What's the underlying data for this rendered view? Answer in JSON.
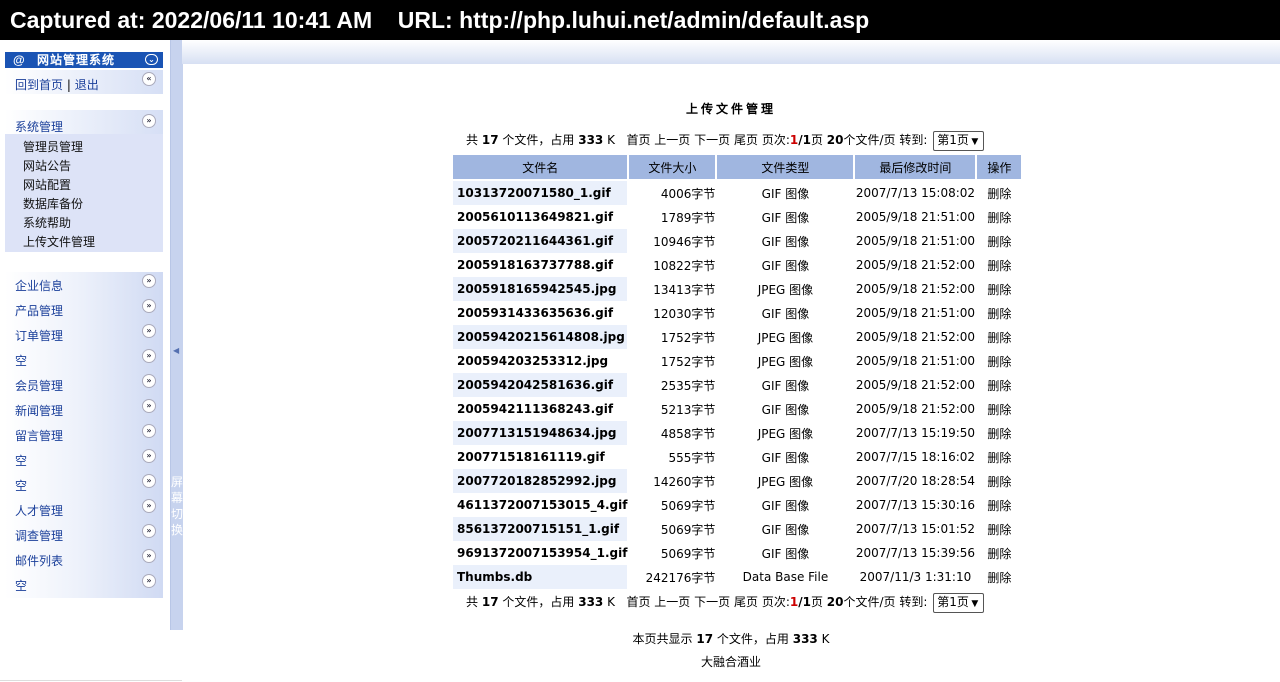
{
  "capture": {
    "text": "Captured at: 2022/06/11 10:41 AM    URL: http://php.luhui.net/admin/default.asp"
  },
  "sidebar": {
    "header_at": "@",
    "title": "网站管理系统",
    "home_link": "回到首页",
    "separator": " | ",
    "logout_link": "退出",
    "system": {
      "label": "系统管理",
      "items": [
        "管理员管理",
        "网站公告",
        "网站配置",
        "数据库备份",
        "系统帮助",
        "上传文件管理"
      ]
    },
    "categories": [
      "企业信息",
      "产品管理",
      "订单管理",
      "空",
      "会员管理",
      "新闻管理",
      "留言管理",
      "空",
      "空",
      "人才管理",
      "调查管理",
      "邮件列表",
      "空"
    ]
  },
  "splitter": {
    "label": "屏幕切换"
  },
  "main": {
    "title": "上传文件管理",
    "summary": {
      "prefix": "共",
      "count": "17",
      "count_unit": "个文件，占用",
      "size": "333",
      "size_unit": "K",
      "first": "首页",
      "prev": "上一页",
      "next": "下一页",
      "last": "尾页",
      "page_label": "页次:",
      "current_page": "1",
      "total_pages": "/1",
      "page_suffix": "页",
      "per_page": "20",
      "per_page_unit": "个文件/页",
      "goto": "转到:",
      "select_value": "第1页"
    },
    "columns": [
      "文件名",
      "文件大小",
      "文件类型",
      "最后修改时间",
      "操作"
    ],
    "rows": [
      {
        "name": "10313720071580_1.gif",
        "size": "4006字节",
        "type": "GIF 图像",
        "modified": "2007/7/13 15:08:02",
        "action": "删除"
      },
      {
        "name": "2005610113649821.gif",
        "size": "1789字节",
        "type": "GIF 图像",
        "modified": "2005/9/18 21:51:00",
        "action": "删除"
      },
      {
        "name": "2005720211644361.gif",
        "size": "10946字节",
        "type": "GIF 图像",
        "modified": "2005/9/18 21:51:00",
        "action": "删除"
      },
      {
        "name": "2005918163737788.gif",
        "size": "10822字节",
        "type": "GIF 图像",
        "modified": "2005/9/18 21:52:00",
        "action": "删除"
      },
      {
        "name": "2005918165942545.jpg",
        "size": "13413字节",
        "type": "JPEG 图像",
        "modified": "2005/9/18 21:52:00",
        "action": "删除"
      },
      {
        "name": "2005931433635636.gif",
        "size": "12030字节",
        "type": "GIF 图像",
        "modified": "2005/9/18 21:51:00",
        "action": "删除"
      },
      {
        "name": "20059420215614808.jpg",
        "size": "1752字节",
        "type": "JPEG 图像",
        "modified": "2005/9/18 21:52:00",
        "action": "删除"
      },
      {
        "name": "200594203253312.jpg",
        "size": "1752字节",
        "type": "JPEG 图像",
        "modified": "2005/9/18 21:51:00",
        "action": "删除"
      },
      {
        "name": "2005942042581636.gif",
        "size": "2535字节",
        "type": "GIF 图像",
        "modified": "2005/9/18 21:52:00",
        "action": "删除"
      },
      {
        "name": "2005942111368243.gif",
        "size": "5213字节",
        "type": "GIF 图像",
        "modified": "2005/9/18 21:52:00",
        "action": "删除"
      },
      {
        "name": "2007713151948634.jpg",
        "size": "4858字节",
        "type": "JPEG 图像",
        "modified": "2007/7/13 15:19:50",
        "action": "删除"
      },
      {
        "name": "200771518161119.gif",
        "size": "555字节",
        "type": "GIF 图像",
        "modified": "2007/7/15 18:16:02",
        "action": "删除"
      },
      {
        "name": "2007720182852992.jpg",
        "size": "14260字节",
        "type": "JPEG 图像",
        "modified": "2007/7/20 18:28:54",
        "action": "删除"
      },
      {
        "name": "4611372007153015_4.gif",
        "size": "5069字节",
        "type": "GIF 图像",
        "modified": "2007/7/13 15:30:16",
        "action": "删除"
      },
      {
        "name": "856137200715151_1.gif",
        "size": "5069字节",
        "type": "GIF 图像",
        "modified": "2007/7/13 15:01:52",
        "action": "删除"
      },
      {
        "name": "9691372007153954_1.gif",
        "size": "5069字节",
        "type": "GIF 图像",
        "modified": "2007/7/13 15:39:56",
        "action": "删除"
      },
      {
        "name": "Thumbs.db",
        "size": "242176字节",
        "type": "Data Base File",
        "modified": "2007/11/3 1:31:10",
        "action": "删除"
      }
    ],
    "footer": {
      "prefix": "本页共显示",
      "count": "17",
      "middle": "个文件，占用",
      "size": "333",
      "unit": "K",
      "company": "大融合酒业"
    }
  },
  "icons": {
    "collapse_left": "double-chevron-left-icon",
    "expand_down": "double-chevron-down-icon",
    "splitter_arrow": "triangle-left-icon"
  }
}
